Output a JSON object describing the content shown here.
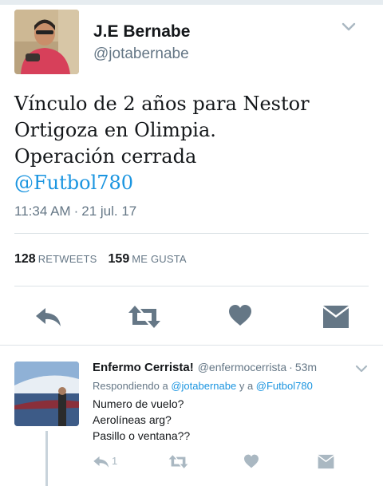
{
  "colors": {
    "text": "#14171a",
    "muted": "#657786",
    "accent": "#1b95e0",
    "icon_main": "#657786",
    "icon_reply": "#aab8c2",
    "divider": "#dde3e7"
  },
  "tweet": {
    "author_name": "J.E Bernabe",
    "author_handle": "@jotabernabe",
    "text_lines": [
      "Vínculo de 2 años para Nestor",
      "Ortigoza en Olimpia.",
      "Operación cerrada"
    ],
    "mention": "@Futbol780",
    "time": "11:34 AM",
    "time_separator": "·",
    "date": "21 jul. 17",
    "retweets_count": "128",
    "retweets_label": "RETWEETS",
    "likes_count": "159",
    "likes_label": "ME GUSTA",
    "icons": [
      "reply-icon",
      "retweet-icon",
      "like-icon",
      "message-icon",
      "chevron-down-icon"
    ]
  },
  "reply": {
    "author_name": "Enfermo Cerrista!",
    "author_handle": "@enfermocerrista",
    "separator": "·",
    "age": "53m",
    "replying_prefix": "Respondiendo a",
    "replying_to_1": "@jotabernabe",
    "replying_connector": "y a",
    "replying_to_2": "@Futbol780",
    "text_lines": [
      "Numero de vuelo?",
      "Aerolíneas arg?",
      "Pasillo o ventana??"
    ],
    "reply_count": "1",
    "icons": [
      "reply-icon",
      "retweet-icon",
      "like-icon",
      "message-icon",
      "chevron-down-icon"
    ]
  }
}
